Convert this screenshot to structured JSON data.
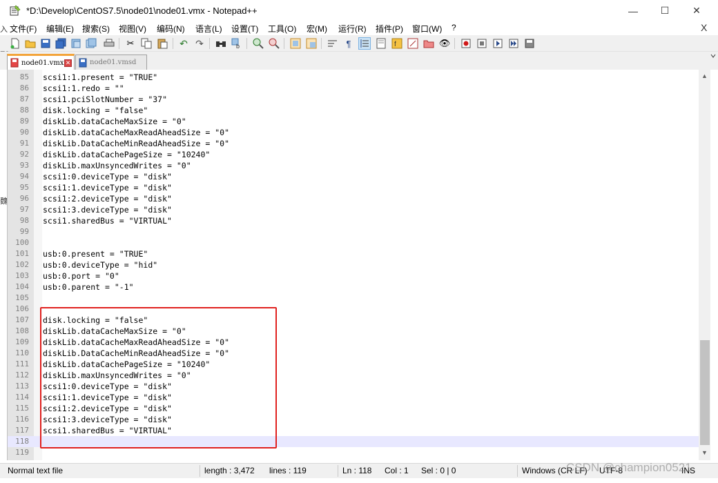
{
  "window": {
    "title": "*D:\\Develop\\CentOS7.5\\node01\\node01.vmx - Notepad++",
    "min_glyph": "—",
    "max_glyph": "☐",
    "close_glyph": "✕"
  },
  "menu": {
    "items": [
      "文件(F)",
      "编辑(E)",
      "搜索(S)",
      "视图(V)",
      "编码(N)",
      "语言(L)",
      "设置(T)",
      "工具(O)",
      "宏(M)",
      "运行(R)",
      "插件(P)",
      "窗口(W)",
      "?"
    ],
    "close_glyph": "X"
  },
  "toolbar": {
    "icons": [
      "new-file",
      "open-file",
      "save",
      "save-all",
      "close",
      "close-all",
      "print",
      "cut",
      "copy",
      "paste",
      "undo",
      "redo",
      "find",
      "replace",
      "zoom-in",
      "zoom-out",
      "sync-vertical",
      "sync-horizontal",
      "word-wrap",
      "show-all-chars",
      "indent-guide",
      "document-map",
      "function-list",
      "folder-as-workspace",
      "monitoring",
      "record-macro",
      "stop-record",
      "play-macro",
      "run-macro-multiple",
      "save-macro"
    ]
  },
  "tabs": [
    {
      "label": "node01.vmx",
      "active": true
    },
    {
      "label": "node01.vmsd",
      "active": false
    }
  ],
  "editor": {
    "lines": [
      {
        "n": "85",
        "t": "scsi1:1.present = \"TRUE\""
      },
      {
        "n": "86",
        "t": "scsi1:1.redo = \"\""
      },
      {
        "n": "87",
        "t": "scsi1.pciSlotNumber = \"37\""
      },
      {
        "n": "88",
        "t": "disk.locking = \"false\""
      },
      {
        "n": "89",
        "t": "diskLib.dataCacheMaxSize = \"0\""
      },
      {
        "n": "90",
        "t": "diskLib.dataCacheMaxReadAheadSize = \"0\""
      },
      {
        "n": "91",
        "t": "diskLib.DataCacheMinReadAheadSize = \"0\""
      },
      {
        "n": "92",
        "t": "diskLib.dataCachePageSize = \"10240\""
      },
      {
        "n": "93",
        "t": "diskLib.maxUnsyncedWrites = \"0\""
      },
      {
        "n": "94",
        "t": "scsi1:0.deviceType = \"disk\""
      },
      {
        "n": "95",
        "t": "scsi1:1.deviceType = \"disk\""
      },
      {
        "n": "96",
        "t": "scsi1:2.deviceType = \"disk\""
      },
      {
        "n": "97",
        "t": "scsi1:3.deviceType = \"disk\""
      },
      {
        "n": "98",
        "t": "scsi1.sharedBus = \"VIRTUAL\""
      },
      {
        "n": "99",
        "t": ""
      },
      {
        "n": "100",
        "t": ""
      },
      {
        "n": "101",
        "t": "usb:0.present = \"TRUE\""
      },
      {
        "n": "102",
        "t": "usb:0.deviceType = \"hid\""
      },
      {
        "n": "103",
        "t": "usb:0.port = \"0\""
      },
      {
        "n": "104",
        "t": "usb:0.parent = \"-1\""
      },
      {
        "n": "105",
        "t": ""
      },
      {
        "n": "106",
        "t": ""
      },
      {
        "n": "107",
        "t": "disk.locking = \"false\""
      },
      {
        "n": "108",
        "t": "diskLib.dataCacheMaxSize = \"0\""
      },
      {
        "n": "109",
        "t": "diskLib.dataCacheMaxReadAheadSize = \"0\""
      },
      {
        "n": "110",
        "t": "diskLib.DataCacheMinReadAheadSize = \"0\""
      },
      {
        "n": "111",
        "t": "diskLib.dataCachePageSize = \"10240\""
      },
      {
        "n": "112",
        "t": "diskLib.maxUnsyncedWrites = \"0\""
      },
      {
        "n": "113",
        "t": "scsi1:0.deviceType = \"disk\""
      },
      {
        "n": "114",
        "t": "scsi1:1.deviceType = \"disk\""
      },
      {
        "n": "115",
        "t": "scsi1:2.deviceType = \"disk\""
      },
      {
        "n": "116",
        "t": "scsi1:3.deviceType = \"disk\""
      },
      {
        "n": "117",
        "t": "scsi1.sharedBus = \"VIRTUAL\""
      },
      {
        "n": "118",
        "t": ""
      },
      {
        "n": "119",
        "t": ""
      }
    ],
    "current_line": "118"
  },
  "statusbar": {
    "file_type": "Normal text file",
    "length": "length : 3,472",
    "lines": "lines : 119",
    "ln": "Ln : 118",
    "col": "Col : 1",
    "sel": "Sel : 0 | 0",
    "eol": "Windows (CR LF)",
    "encoding": "UTF-8",
    "mode": "INS"
  },
  "watermark": "CSDN @champion0521",
  "colors": {
    "highlight_box": "#e0201e",
    "active_tab_accent": "#f3a43a",
    "current_line": "#e8e8ff"
  }
}
